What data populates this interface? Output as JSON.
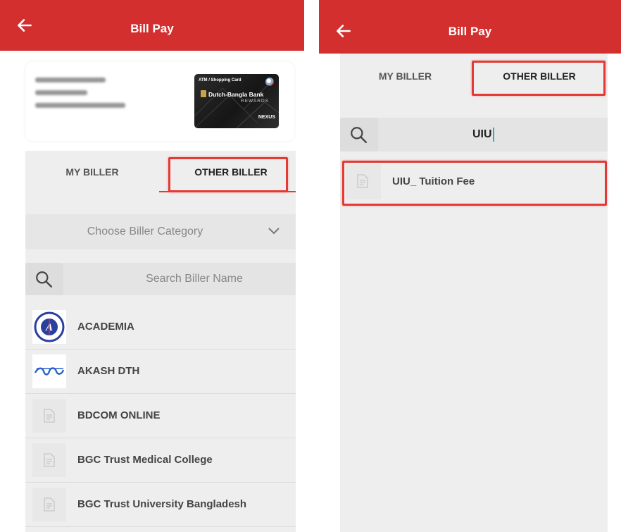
{
  "left": {
    "header": {
      "title": "Bill Pay"
    },
    "card": {
      "brand": "Dutch-Bangla Bank",
      "tier": "REWARDS",
      "type": "ATM / Shopping Card",
      "network": "NEXUS"
    },
    "tabs": [
      {
        "label": "MY BILLER",
        "active": false
      },
      {
        "label": "OTHER BILLER",
        "active": true
      }
    ],
    "category": {
      "label": "Choose Biller Category"
    },
    "search": {
      "placeholder": "Search Biller Name"
    },
    "billers": [
      {
        "name": "ACADEMIA",
        "icon": "academia-logo"
      },
      {
        "name": "AKASH DTH",
        "icon": "akash-logo"
      },
      {
        "name": "BDCOM ONLINE",
        "icon": "document-icon"
      },
      {
        "name": "BGC Trust Medical College",
        "icon": "document-icon"
      },
      {
        "name": "BGC Trust University Bangladesh",
        "icon": "document-icon"
      }
    ]
  },
  "right": {
    "header": {
      "title": "Bill Pay"
    },
    "tabs": [
      {
        "label": "MY BILLER",
        "active": false
      },
      {
        "label": "OTHER BILLER",
        "active": true
      }
    ],
    "search": {
      "value": "UIU"
    },
    "results": [
      {
        "name": "UIU_ Tuition Fee",
        "icon": "document-icon"
      }
    ]
  },
  "colors": {
    "appbar": "#d32f2f",
    "highlight": "#e53935",
    "cursor": "#29a8e0",
    "panel": "#eeeeee"
  }
}
